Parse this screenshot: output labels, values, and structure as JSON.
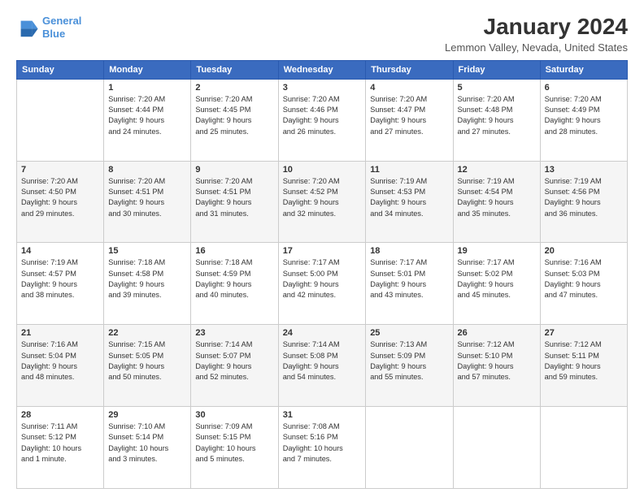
{
  "logo": {
    "line1": "General",
    "line2": "Blue"
  },
  "title": "January 2024",
  "subtitle": "Lemmon Valley, Nevada, United States",
  "days_of_week": [
    "Sunday",
    "Monday",
    "Tuesday",
    "Wednesday",
    "Thursday",
    "Friday",
    "Saturday"
  ],
  "weeks": [
    [
      {
        "num": "",
        "info": ""
      },
      {
        "num": "1",
        "info": "Sunrise: 7:20 AM\nSunset: 4:44 PM\nDaylight: 9 hours\nand 24 minutes."
      },
      {
        "num": "2",
        "info": "Sunrise: 7:20 AM\nSunset: 4:45 PM\nDaylight: 9 hours\nand 25 minutes."
      },
      {
        "num": "3",
        "info": "Sunrise: 7:20 AM\nSunset: 4:46 PM\nDaylight: 9 hours\nand 26 minutes."
      },
      {
        "num": "4",
        "info": "Sunrise: 7:20 AM\nSunset: 4:47 PM\nDaylight: 9 hours\nand 27 minutes."
      },
      {
        "num": "5",
        "info": "Sunrise: 7:20 AM\nSunset: 4:48 PM\nDaylight: 9 hours\nand 27 minutes."
      },
      {
        "num": "6",
        "info": "Sunrise: 7:20 AM\nSunset: 4:49 PM\nDaylight: 9 hours\nand 28 minutes."
      }
    ],
    [
      {
        "num": "7",
        "info": "Sunrise: 7:20 AM\nSunset: 4:50 PM\nDaylight: 9 hours\nand 29 minutes."
      },
      {
        "num": "8",
        "info": "Sunrise: 7:20 AM\nSunset: 4:51 PM\nDaylight: 9 hours\nand 30 minutes."
      },
      {
        "num": "9",
        "info": "Sunrise: 7:20 AM\nSunset: 4:51 PM\nDaylight: 9 hours\nand 31 minutes."
      },
      {
        "num": "10",
        "info": "Sunrise: 7:20 AM\nSunset: 4:52 PM\nDaylight: 9 hours\nand 32 minutes."
      },
      {
        "num": "11",
        "info": "Sunrise: 7:19 AM\nSunset: 4:53 PM\nDaylight: 9 hours\nand 34 minutes."
      },
      {
        "num": "12",
        "info": "Sunrise: 7:19 AM\nSunset: 4:54 PM\nDaylight: 9 hours\nand 35 minutes."
      },
      {
        "num": "13",
        "info": "Sunrise: 7:19 AM\nSunset: 4:56 PM\nDaylight: 9 hours\nand 36 minutes."
      }
    ],
    [
      {
        "num": "14",
        "info": "Sunrise: 7:19 AM\nSunset: 4:57 PM\nDaylight: 9 hours\nand 38 minutes."
      },
      {
        "num": "15",
        "info": "Sunrise: 7:18 AM\nSunset: 4:58 PM\nDaylight: 9 hours\nand 39 minutes."
      },
      {
        "num": "16",
        "info": "Sunrise: 7:18 AM\nSunset: 4:59 PM\nDaylight: 9 hours\nand 40 minutes."
      },
      {
        "num": "17",
        "info": "Sunrise: 7:17 AM\nSunset: 5:00 PM\nDaylight: 9 hours\nand 42 minutes."
      },
      {
        "num": "18",
        "info": "Sunrise: 7:17 AM\nSunset: 5:01 PM\nDaylight: 9 hours\nand 43 minutes."
      },
      {
        "num": "19",
        "info": "Sunrise: 7:17 AM\nSunset: 5:02 PM\nDaylight: 9 hours\nand 45 minutes."
      },
      {
        "num": "20",
        "info": "Sunrise: 7:16 AM\nSunset: 5:03 PM\nDaylight: 9 hours\nand 47 minutes."
      }
    ],
    [
      {
        "num": "21",
        "info": "Sunrise: 7:16 AM\nSunset: 5:04 PM\nDaylight: 9 hours\nand 48 minutes."
      },
      {
        "num": "22",
        "info": "Sunrise: 7:15 AM\nSunset: 5:05 PM\nDaylight: 9 hours\nand 50 minutes."
      },
      {
        "num": "23",
        "info": "Sunrise: 7:14 AM\nSunset: 5:07 PM\nDaylight: 9 hours\nand 52 minutes."
      },
      {
        "num": "24",
        "info": "Sunrise: 7:14 AM\nSunset: 5:08 PM\nDaylight: 9 hours\nand 54 minutes."
      },
      {
        "num": "25",
        "info": "Sunrise: 7:13 AM\nSunset: 5:09 PM\nDaylight: 9 hours\nand 55 minutes."
      },
      {
        "num": "26",
        "info": "Sunrise: 7:12 AM\nSunset: 5:10 PM\nDaylight: 9 hours\nand 57 minutes."
      },
      {
        "num": "27",
        "info": "Sunrise: 7:12 AM\nSunset: 5:11 PM\nDaylight: 9 hours\nand 59 minutes."
      }
    ],
    [
      {
        "num": "28",
        "info": "Sunrise: 7:11 AM\nSunset: 5:12 PM\nDaylight: 10 hours\nand 1 minute."
      },
      {
        "num": "29",
        "info": "Sunrise: 7:10 AM\nSunset: 5:14 PM\nDaylight: 10 hours\nand 3 minutes."
      },
      {
        "num": "30",
        "info": "Sunrise: 7:09 AM\nSunset: 5:15 PM\nDaylight: 10 hours\nand 5 minutes."
      },
      {
        "num": "31",
        "info": "Sunrise: 7:08 AM\nSunset: 5:16 PM\nDaylight: 10 hours\nand 7 minutes."
      },
      {
        "num": "",
        "info": ""
      },
      {
        "num": "",
        "info": ""
      },
      {
        "num": "",
        "info": ""
      }
    ]
  ]
}
